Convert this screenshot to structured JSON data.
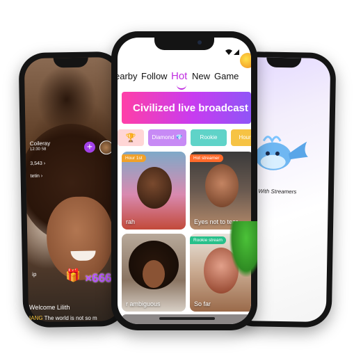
{
  "left_phone": {
    "user_name": "Coileray",
    "user_id": "12:30 58",
    "viewer_count": "3,543 ›",
    "label": "tetin ›",
    "side_label": "ip",
    "gift_count": "×666",
    "welcome_text": "Welcome Lilith",
    "chat_tag": "IANG",
    "chat_text": "The world is not so m"
  },
  "center_phone": {
    "tabs": [
      "earby",
      "Follow",
      "Hot",
      "New",
      "Game"
    ],
    "active_tab": "Hot",
    "banner_title": "Civilized live broadcast",
    "categories": [
      "",
      "Diamond",
      "Rookie",
      "Hour"
    ],
    "cards": [
      {
        "badge": "Hour 1st",
        "label": "rah",
        "badge_color": "#f0a12a"
      },
      {
        "badge": "Hot streamer",
        "label": "Eyes not to tear",
        "badge_color": "#ff6a2b"
      },
      {
        "badge": "",
        "label": "r ambiguous",
        "badge_color": ""
      },
      {
        "badge": "Rookie stream",
        "label": "So far",
        "badge_color": "#27c08a"
      }
    ]
  },
  "right_phone": {
    "slogan": "er With Streamers"
  },
  "colors": {
    "accent": "#c02fe0",
    "banner_start": "#ff3fa7",
    "banner_end": "#8f55f7"
  }
}
